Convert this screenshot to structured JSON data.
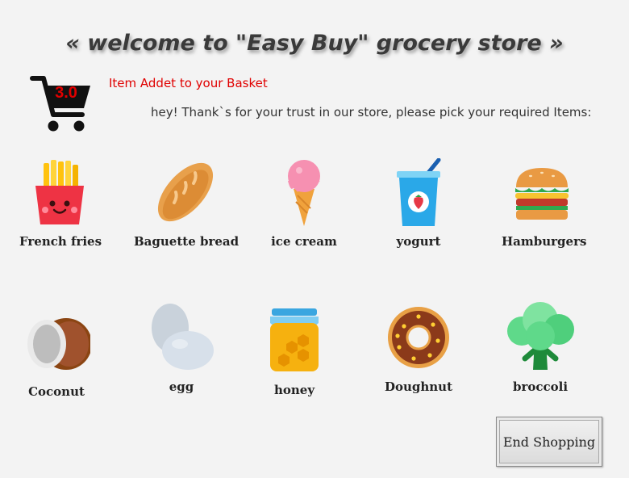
{
  "header": {
    "title": "« welcome to \"Easy Buy\" grocery store »"
  },
  "cart": {
    "count": "3.0",
    "message": "Item Addet to your Basket"
  },
  "greeting": "hey! Thank`s for your trust in our store, please pick your required Items:",
  "items": [
    {
      "label": "French fries",
      "icon": "french-fries-icon"
    },
    {
      "label": "Baguette bread",
      "icon": "baguette-icon"
    },
    {
      "label": "ice cream",
      "icon": "ice-cream-icon"
    },
    {
      "label": "yogurt",
      "icon": "yogurt-icon"
    },
    {
      "label": "Hamburgers",
      "icon": "hamburger-icon"
    },
    {
      "label": "Coconut",
      "icon": "coconut-icon"
    },
    {
      "label": "egg",
      "icon": "egg-icon"
    },
    {
      "label": "honey",
      "icon": "honey-icon"
    },
    {
      "label": "Doughnut",
      "icon": "doughnut-icon"
    },
    {
      "label": "broccoli",
      "icon": "broccoli-icon"
    }
  ],
  "end_button": {
    "label": "End Shopping"
  },
  "colors": {
    "alert": "#e00000",
    "background": "#f3f3f3"
  }
}
